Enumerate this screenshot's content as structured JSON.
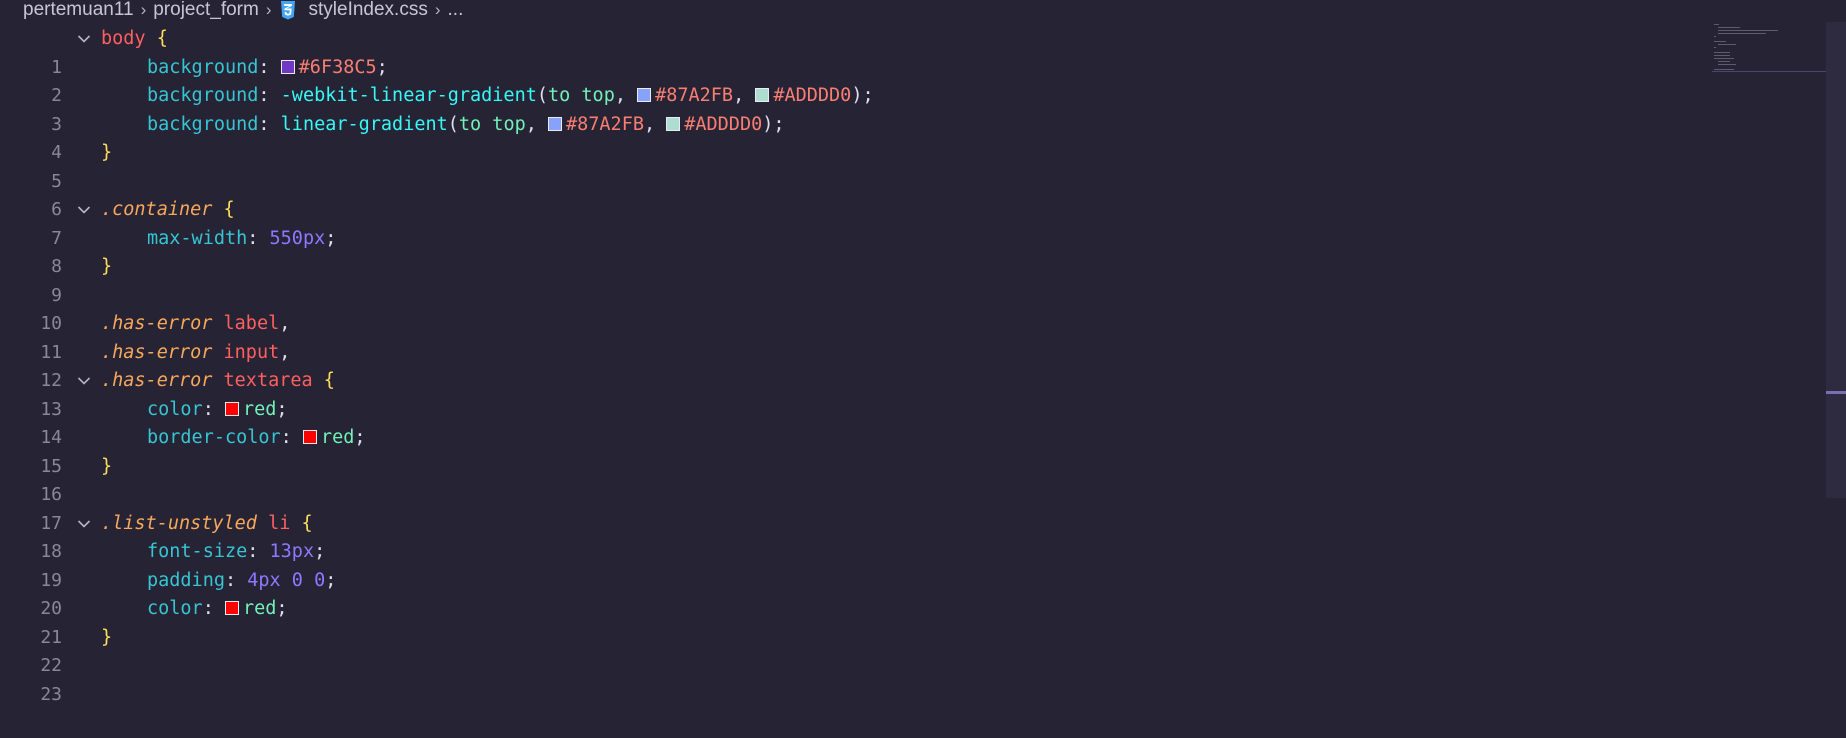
{
  "breadcrumb": {
    "items": [
      "pertemuan11",
      "project_form",
      "styleIndex.css",
      "..."
    ]
  },
  "editor": {
    "language": "css",
    "lines": [
      {
        "n": "1"
      },
      {
        "n": "2"
      },
      {
        "n": "3"
      },
      {
        "n": "4"
      },
      {
        "n": "5"
      },
      {
        "n": "6"
      },
      {
        "n": "7"
      },
      {
        "n": "8"
      },
      {
        "n": "9"
      },
      {
        "n": "10"
      },
      {
        "n": "11"
      },
      {
        "n": "12"
      },
      {
        "n": "13"
      },
      {
        "n": "14"
      },
      {
        "n": "15"
      },
      {
        "n": "16"
      },
      {
        "n": "17"
      },
      {
        "n": "18"
      },
      {
        "n": "19"
      },
      {
        "n": "20"
      },
      {
        "n": "21"
      },
      {
        "n": "22"
      },
      {
        "n": "23"
      }
    ],
    "code": {
      "l1": {
        "sel": "body",
        "brace": "{"
      },
      "l2": {
        "prop": "background",
        "colon": ":",
        "hex": "#6F38C5",
        "semi": ";"
      },
      "l3": {
        "prop": "background",
        "colon": ":",
        "fn": "-webkit-linear-gradient",
        "open": "(",
        "kw": "to top",
        "comma1": ",",
        "hex1": "#87A2FB",
        "comma2": ",",
        "hex2": "#ADDDD0",
        "close": ");"
      },
      "l4": {
        "prop": "background",
        "colon": ":",
        "fn": "linear-gradient",
        "open": "(",
        "kw": "to top",
        "comma1": ",",
        "hex1": "#87A2FB",
        "comma2": ",",
        "hex2": "#ADDDD0",
        "close": ");"
      },
      "l5": {
        "brace": "}"
      },
      "l7": {
        "sel": ".container",
        "brace": "{"
      },
      "l8": {
        "prop": "max-width",
        "colon": ":",
        "num": "550px",
        "semi": ";"
      },
      "l9": {
        "brace": "}"
      },
      "l11": {
        "cls": ".has-error",
        "tag": "label",
        "comma": ","
      },
      "l12": {
        "cls": ".has-error",
        "tag": "input",
        "comma": ","
      },
      "l13": {
        "cls": ".has-error",
        "tag": "textarea",
        "brace": "{"
      },
      "l14": {
        "prop": "color",
        "colon": ":",
        "val": "red",
        "semi": ";"
      },
      "l15": {
        "prop": "border-color",
        "colon": ":",
        "val": "red",
        "semi": ";"
      },
      "l16": {
        "brace": "}"
      },
      "l18": {
        "cls": ".list-unstyled",
        "tag": "li",
        "brace": "{"
      },
      "l19": {
        "prop": "font-size",
        "colon": ":",
        "num": "13px",
        "semi": ";"
      },
      "l20": {
        "prop": "padding",
        "colon": ":",
        "num": "4px 0 0",
        "semi": ";"
      },
      "l21": {
        "prop": "color",
        "colon": ":",
        "val": "red",
        "semi": ";"
      },
      "l22": {
        "brace": "}"
      }
    },
    "swatch_colors": {
      "purple": "#6F38C5",
      "blue": "#87A2FB",
      "mint": "#ADDDD0",
      "red": "#FF0000"
    }
  },
  "theme": {
    "background": "#262335",
    "css_icon_color": "#42a5f5"
  }
}
